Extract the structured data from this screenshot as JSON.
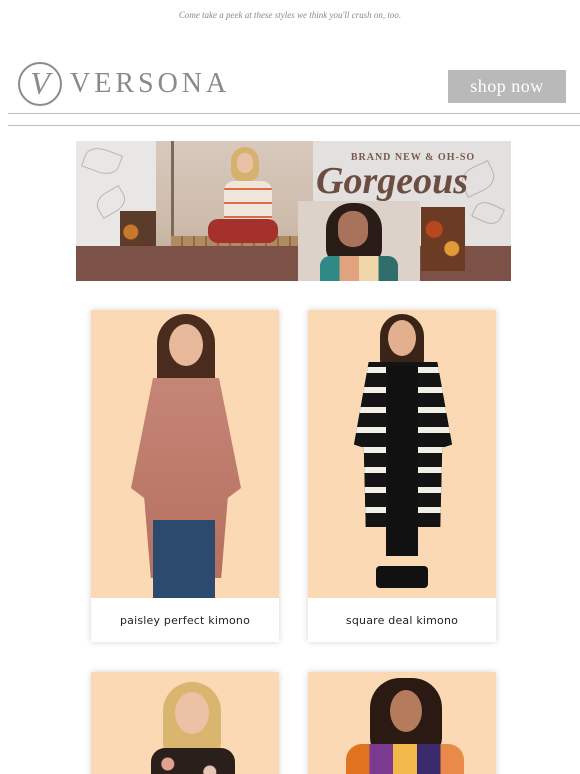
{
  "preheader": "Come take a peek at these styles we think you'll crush on, too.",
  "brand": {
    "logo_letter": "V",
    "name": "VERSONA"
  },
  "cta": {
    "label": "shop now"
  },
  "banner": {
    "kicker": "BRAND NEW & OH-SO",
    "headline": "Gorgeous"
  },
  "products": [
    {
      "name": "paisley perfect kimono"
    },
    {
      "name": "square deal kimono"
    },
    {
      "name": ""
    },
    {
      "name": ""
    }
  ],
  "colors": {
    "brand_gray": "#8a8a8a",
    "cta_bg": "#b9b9b9",
    "banner_accent": "#7b5148",
    "product_bg": "#fbd9b4"
  }
}
